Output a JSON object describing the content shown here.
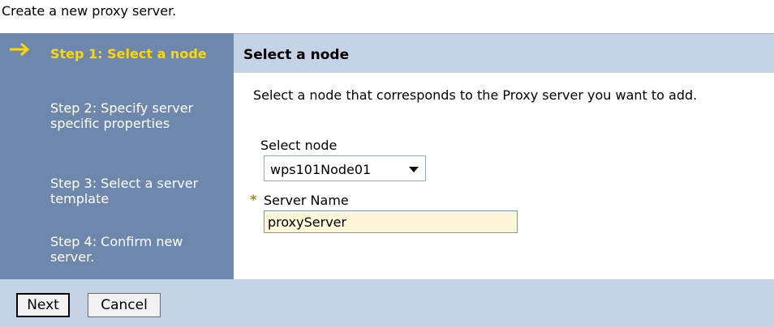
{
  "intro_text": "Create a new proxy server.",
  "sidebar": {
    "steps": [
      {
        "label": "Step 1: Select a node",
        "current": true
      },
      {
        "label": "Step 2: Specify server specific properties",
        "current": false
      },
      {
        "label": "Step 3: Select a server template",
        "current": false
      },
      {
        "label": "Step 4: Confirm new server.",
        "current": false
      }
    ]
  },
  "main": {
    "title": "Select a node",
    "description": "Select a node that corresponds to the Proxy server you want to add.",
    "node_select": {
      "label": "Select node",
      "value": "wps101Node01"
    },
    "server_name": {
      "required_mark": "*",
      "label": "Server Name",
      "value": "proxyServer"
    }
  },
  "footer": {
    "next_label": "Next",
    "cancel_label": "Cancel"
  },
  "colors": {
    "sidebar_bg": "#6e87ad",
    "current_step": "#ffd700",
    "header_bg": "#c5d3e6",
    "input_bg": "#fdf7d8"
  }
}
